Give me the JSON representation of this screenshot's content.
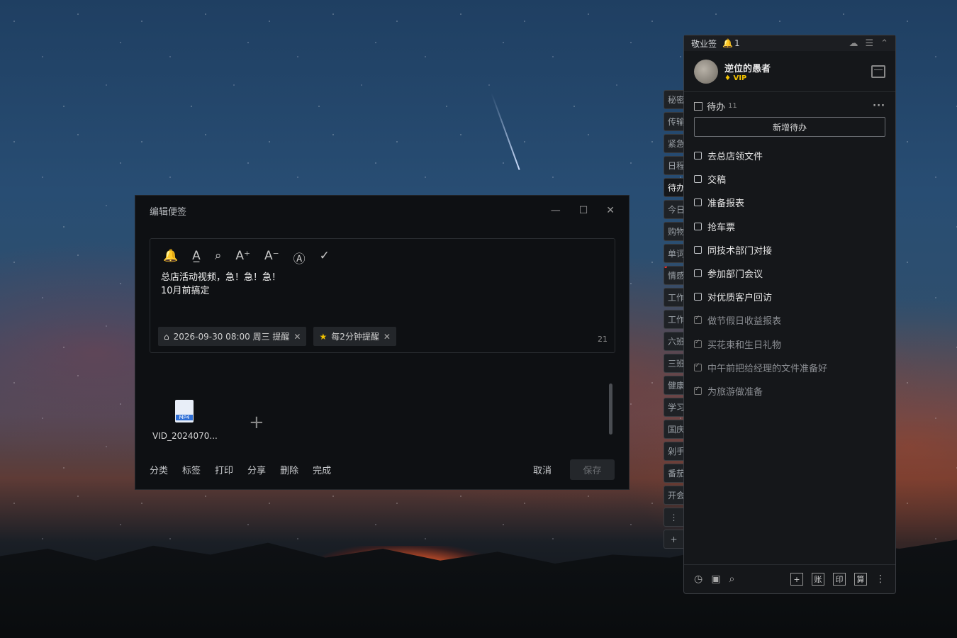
{
  "app": {
    "name": "敬业签",
    "notification_count": "1"
  },
  "user": {
    "name": "逆位的愚者",
    "badge": "VIP"
  },
  "todo": {
    "title": "待办",
    "count": "11",
    "add_label": "新增待办",
    "items": [
      {
        "text": "去总店领文件",
        "done": false
      },
      {
        "text": "交稿",
        "done": false
      },
      {
        "text": "准备报表",
        "done": false
      },
      {
        "text": "抢车票",
        "done": false
      },
      {
        "text": "同技术部门对接",
        "done": false
      },
      {
        "text": "参加部门会议",
        "done": false
      },
      {
        "text": "对优质客户回访",
        "done": false
      },
      {
        "text": "做节假日收益报表",
        "done": true
      },
      {
        "text": "买花束和生日礼物",
        "done": true
      },
      {
        "text": "中午前把给经理的文件准备好",
        "done": true
      },
      {
        "text": "为旅游做准备",
        "done": true
      }
    ]
  },
  "tabs": [
    "秘密",
    "传输",
    "紧急",
    "日程",
    "待办",
    "今日",
    "购物",
    "单词",
    "情感",
    "工作",
    "工作",
    "六班",
    "三班",
    "健康",
    "学习",
    "国庆",
    "剁手",
    "番茄",
    "开会"
  ],
  "bottom_bar": {
    "btn1": "账",
    "btn2": "印",
    "btn3": "算"
  },
  "editor": {
    "title": "编辑便签",
    "line1": "总店活动视频，急！急！急！",
    "line2": "10月前搞定",
    "reminder_chip": "2026-09-30 08:00 周三 提醒",
    "repeat_chip": "每2分钟提醒",
    "char_count": "21",
    "attachment_name": "VID_2024070...",
    "attachment_type": "MP4"
  },
  "footer": {
    "classify": "分类",
    "tag": "标签",
    "print": "打印",
    "share": "分享",
    "delete": "删除",
    "complete": "完成",
    "cancel": "取消",
    "save": "保存"
  }
}
